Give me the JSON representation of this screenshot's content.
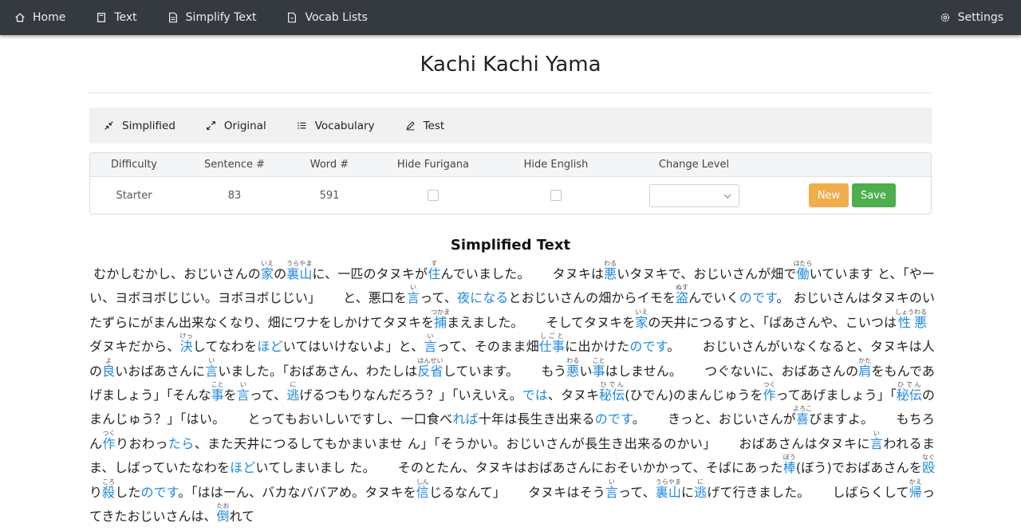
{
  "nav": {
    "items": [
      {
        "label": "Home",
        "icon": "home-icon"
      },
      {
        "label": "Text",
        "icon": "book-icon"
      },
      {
        "label": "Simplify Text",
        "icon": "file-text-icon"
      },
      {
        "label": "Vocab Lists",
        "icon": "file-list-icon"
      }
    ],
    "settings_label": "Settings"
  },
  "page_title": "Kachi Kachi Yama",
  "tabs": [
    {
      "label": "Simplified",
      "icon": "minimize-icon"
    },
    {
      "label": "Original",
      "icon": "expand-icon"
    },
    {
      "label": "Vocabulary",
      "icon": "list-icon"
    },
    {
      "label": "Test",
      "icon": "pencil-icon"
    }
  ],
  "controls": {
    "headers": [
      "Difficulty",
      "Sentence #",
      "Word #",
      "Hide Furigana",
      "Hide English",
      "Change Level"
    ],
    "difficulty": "Starter",
    "sentence_count": "83",
    "word_count": "591",
    "hide_furigana": false,
    "hide_english": false,
    "level_value": "",
    "new_label": "New",
    "save_label": "Save"
  },
  "section_title": "Simplified Text",
  "colors": {
    "navbar": "#343a40",
    "link": "#1e88e5",
    "new_button": "#f0ad4e",
    "save_button": "#4cae4c"
  }
}
